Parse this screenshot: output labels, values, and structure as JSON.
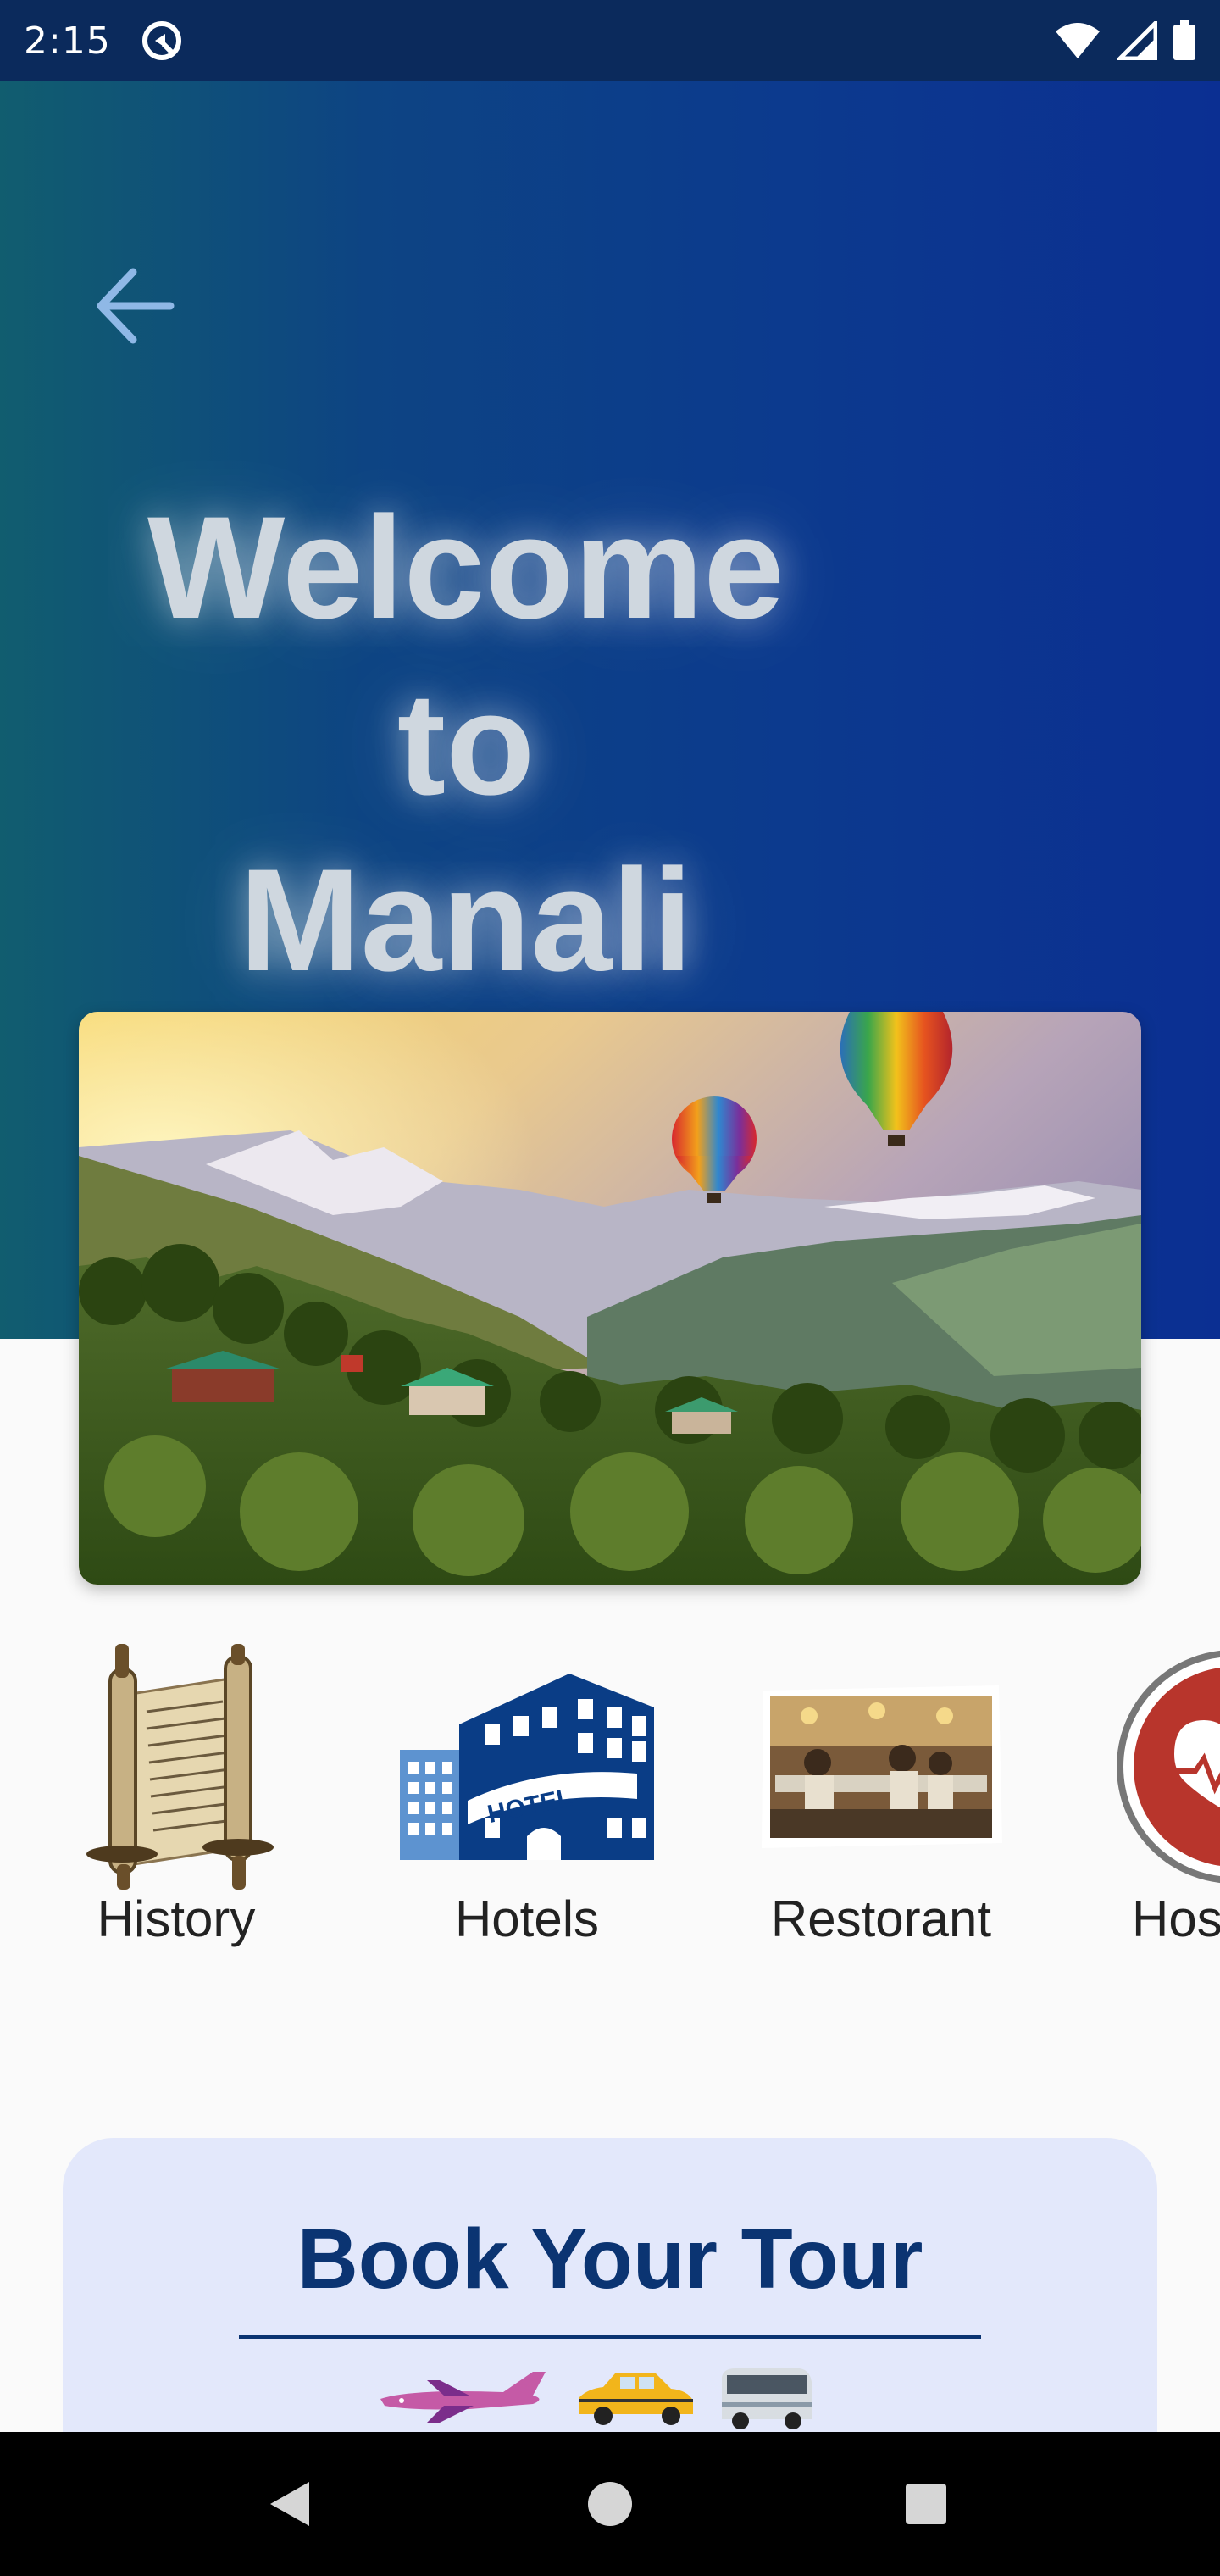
{
  "status_bar": {
    "time": "2:15",
    "icons": [
      "app-notification-icon",
      "wifi-icon",
      "signal-icon",
      "battery-icon"
    ]
  },
  "header": {
    "back_icon": "arrow-left-icon",
    "title_lines": [
      "Welcome",
      "to",
      "Manali"
    ]
  },
  "hero_image": {
    "alt": "Manali valley with hot air balloons"
  },
  "categories": [
    {
      "label": "History",
      "icon": "scroll-icon"
    },
    {
      "label": "Hotels",
      "icon": "hotel-building-icon"
    },
    {
      "label": "Restorant",
      "icon": "restaurant-photo-icon"
    },
    {
      "label": "Hos",
      "icon": "hospital-heart-icon"
    }
  ],
  "tour_card": {
    "title": "Book Your Tour",
    "transport_icons": [
      "airplane-icon",
      "taxi-icon",
      "bus-icon"
    ]
  },
  "nav_bar": {
    "icons": [
      "back-triangle-icon",
      "home-circle-icon",
      "recents-square-icon"
    ]
  },
  "colors": {
    "hero_start": "#115d6f",
    "hero_end": "#0b2f92",
    "tour_card_bg": "#e3e8fb",
    "tour_title": "#0b3472",
    "hotel_blue": "#0a3d86"
  }
}
